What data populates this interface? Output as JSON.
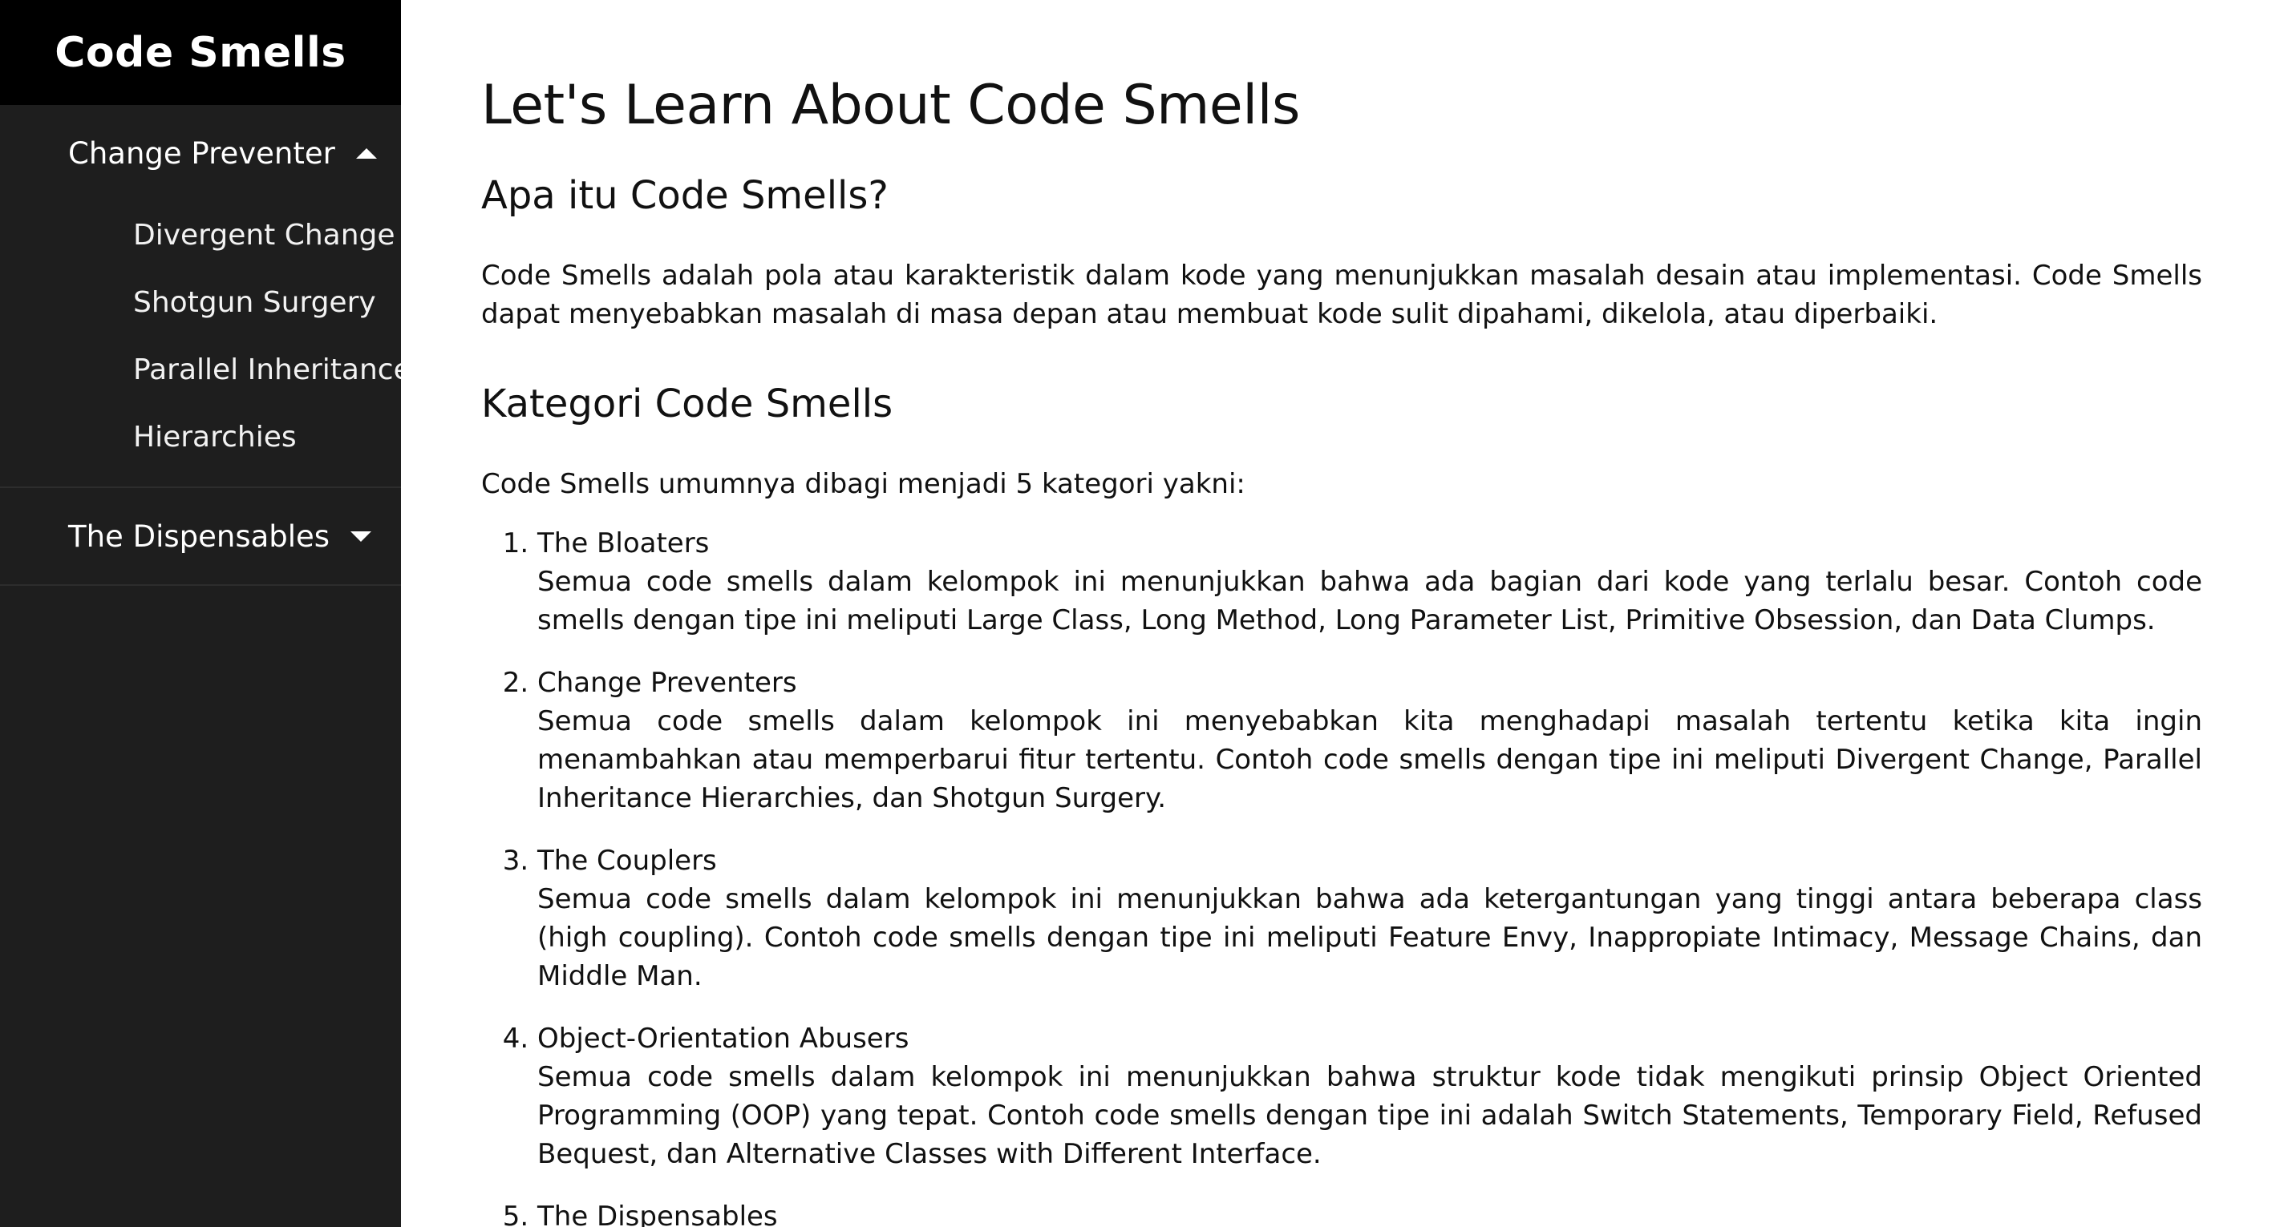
{
  "sidebar": {
    "brand": "Code Smells",
    "groups": [
      {
        "label": "Change Preventer",
        "expanded": true,
        "items": [
          "Divergent Change",
          "Shotgun Surgery",
          "Parallel Inheritance",
          "Hierarchies"
        ]
      },
      {
        "label": "The Dispensables",
        "expanded": false,
        "items": []
      }
    ]
  },
  "main": {
    "title": "Let's Learn About Code Smells",
    "section1": {
      "heading": "Apa itu Code Smells?",
      "body": "Code Smells adalah pola atau karakteristik dalam kode yang menunjukkan masalah desain atau implementasi. Code Smells dapat menyebabkan masalah di masa depan atau membuat kode sulit dipahami, dikelola, atau diperbaiki."
    },
    "section2": {
      "heading": "Kategori Code Smells",
      "intro": "Code Smells umumnya dibagi menjadi 5 kategori yakni:",
      "categories": [
        {
          "title": "The Bloaters",
          "description": "Semua code smells dalam kelompok ini menunjukkan bahwa ada bagian dari kode yang terlalu besar. Contoh code smells dengan tipe ini meliputi Large Class, Long Method, Long Parameter List, Primitive Obsession, dan Data Clumps."
        },
        {
          "title": "Change Preventers",
          "description": "Semua code smells dalam kelompok ini menyebabkan kita menghadapi masalah tertentu ketika kita ingin menambahkan atau memperbarui fitur tertentu. Contoh code smells dengan tipe ini meliputi Divergent Change, Parallel Inheritance Hierarchies, dan Shotgun Surgery."
        },
        {
          "title": "The Couplers",
          "description": "Semua code smells dalam kelompok ini menunjukkan bahwa ada ketergantungan yang tinggi antara beberapa class (high coupling). Contoh code smells dengan tipe ini meliputi Feature Envy, Inappropiate Intimacy, Message Chains, dan Middle Man."
        },
        {
          "title": "Object-Orientation Abusers",
          "description": "Semua code smells dalam kelompok ini menunjukkan bahwa struktur kode tidak mengikuti prinsip Object Oriented Programming (OOP) yang tepat. Contoh code smells dengan tipe ini adalah Switch Statements, Temporary Field, Refused Bequest, dan Alternative Classes with Different Interface."
        },
        {
          "title": "The Dispensables",
          "description": ""
        }
      ]
    }
  },
  "colors": {
    "sidebar_bg": "#1e1e1e",
    "brand_bg": "#000000",
    "text_light": "#ffffff",
    "main_bg": "#ffffff",
    "text_dark": "#111111"
  },
  "icons": {
    "expanded": "caret-up-icon",
    "collapsed": "caret-down-icon"
  }
}
